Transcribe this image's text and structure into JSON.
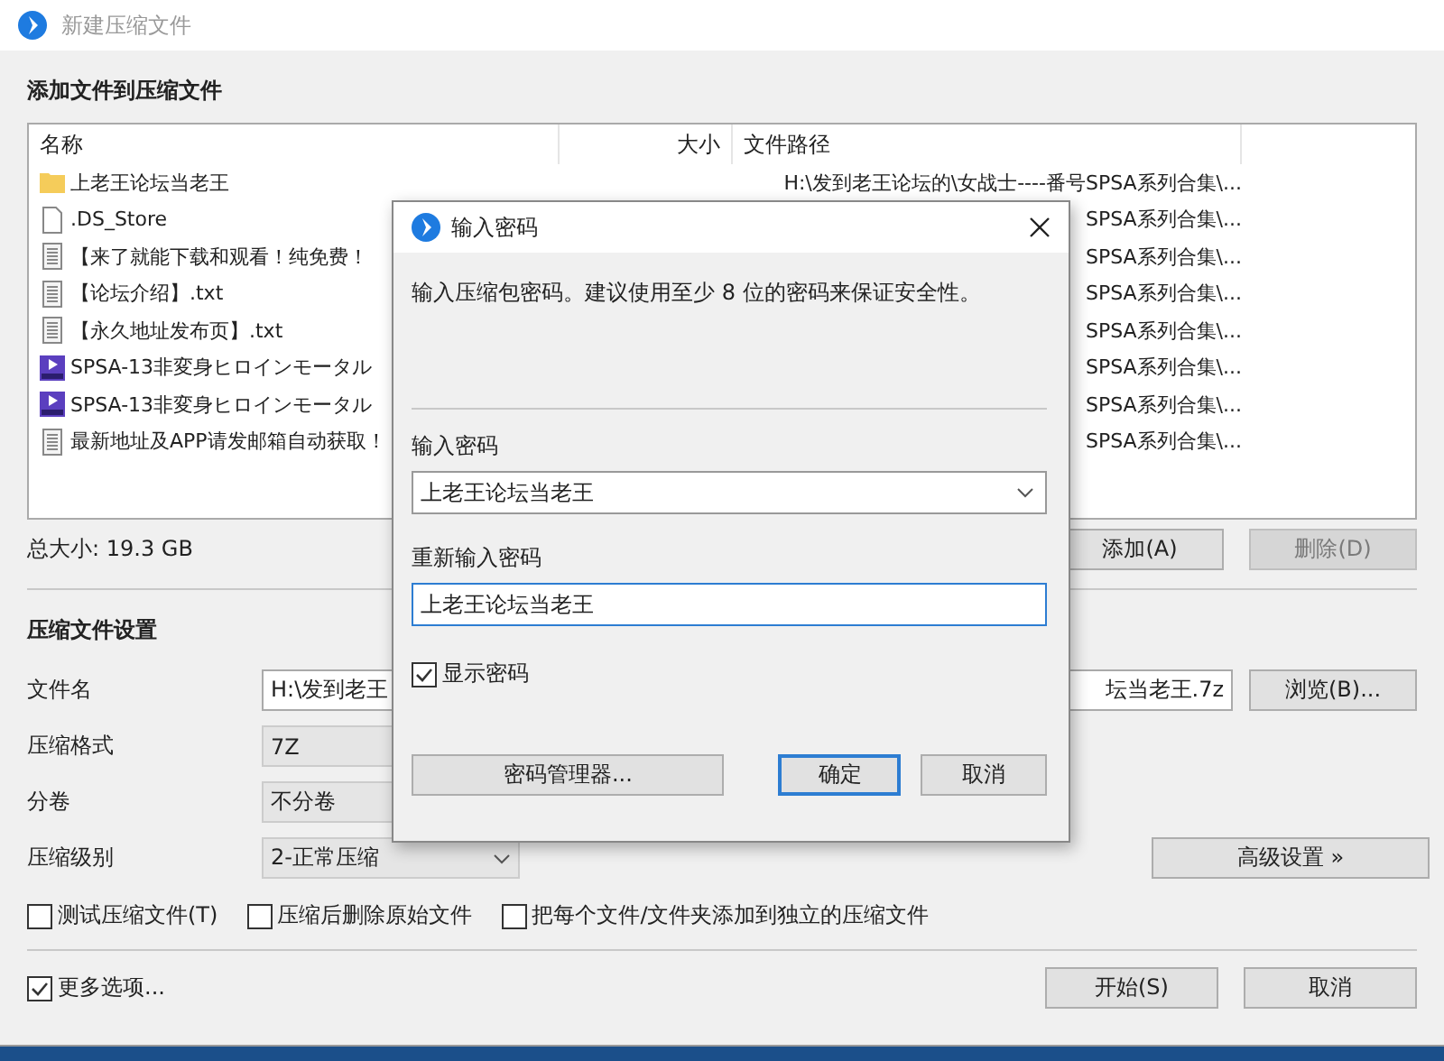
{
  "window": {
    "title": "新建压缩文件"
  },
  "files_section": {
    "heading": "添加文件到压缩文件",
    "columns": [
      "名称",
      "大小",
      "文件路径"
    ],
    "rows": [
      {
        "kind": "folder",
        "name": "上老王论坛当老王",
        "path": "H:\\发到老王论坛的\\女战士----番号SPSA系列合集\\..."
      },
      {
        "kind": "file",
        "name": ".DS_Store",
        "path": "SPSA系列合集\\..."
      },
      {
        "kind": "text",
        "name": "【来了就能下载和观看！纯免费！",
        "path": "SPSA系列合集\\..."
      },
      {
        "kind": "text",
        "name": "【论坛介绍】.txt",
        "path": "SPSA系列合集\\..."
      },
      {
        "kind": "text",
        "name": "【永久地址发布页】.txt",
        "path": "SPSA系列合集\\..."
      },
      {
        "kind": "video",
        "name": "SPSA-13非変身ヒロインモータル",
        "path": "SPSA系列合集\\..."
      },
      {
        "kind": "video",
        "name": "SPSA-13非変身ヒロインモータル",
        "path": "SPSA系列合集\\..."
      },
      {
        "kind": "text",
        "name": "最新地址及APP请发邮箱自动获取！",
        "path": "SPSA系列合集\\..."
      }
    ]
  },
  "total_size": "总大小: 19.3 GB",
  "list_buttons": [
    {
      "label": "添加(A)",
      "disabled": false
    },
    {
      "label": "删除(D)",
      "disabled": true
    }
  ],
  "settings": {
    "heading": "压缩文件设置",
    "fields": [
      {
        "kind": "text-field",
        "label": "文件名",
        "value_parts": [
          "H:\\发到老王",
          "坛当老王.7z"
        ],
        "button": "浏览(B)..."
      },
      {
        "kind": "wide-combo",
        "label": "压缩格式",
        "value": "7Z"
      },
      {
        "kind": "wide-combo",
        "label": "分卷",
        "value": "不分卷"
      },
      {
        "kind": "combo",
        "label": "压缩级别",
        "value": "2-正常压缩",
        "button": "高级设置 »"
      }
    ],
    "options": [
      {
        "label": "测试压缩文件(T)",
        "checked": false
      },
      {
        "label": "压缩后删除原始文件",
        "checked": false
      },
      {
        "label": "把每个文件/文件夹添加到独立的压缩文件",
        "checked": false
      }
    ]
  },
  "more_options": {
    "label": "更多选项...",
    "checked": true
  },
  "footer_buttons": [
    {
      "label": "开始(S)"
    },
    {
      "label": "取消"
    }
  ],
  "password_dialog": {
    "title": "输入密码",
    "message": "输入压缩包密码。建议使用至少 8 位的密码来保证安全性。",
    "password": {
      "label": "输入密码",
      "value": "上老王论坛当老王"
    },
    "confirm": {
      "label": "重新输入密码",
      "value": "上老王论坛当老王"
    },
    "show_password": {
      "label": "显示密码",
      "checked": true
    },
    "buttons": [
      {
        "label": "密码管理器...",
        "default": false
      },
      {
        "label": "确定",
        "default": true
      },
      {
        "label": "取消",
        "default": false
      }
    ]
  }
}
